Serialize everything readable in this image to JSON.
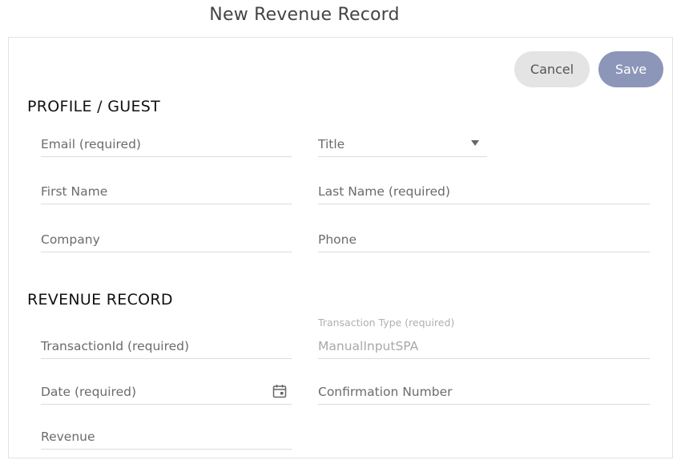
{
  "page": {
    "title": "New Revenue Record"
  },
  "actions": {
    "cancel_label": "Cancel",
    "save_label": "Save"
  },
  "sections": {
    "profile": {
      "title": "PROFILE / GUEST",
      "fields": {
        "email": "Email (required)",
        "title": "Title",
        "first_name": "First Name",
        "last_name": "Last Name (required)",
        "company": "Company",
        "phone": "Phone"
      }
    },
    "revenue": {
      "title": "REVENUE RECORD",
      "fields": {
        "transaction_id": "TransactionId (required)",
        "transaction_type_label": "Transaction Type (required)",
        "transaction_type_value": "ManualInputSPA",
        "date": "Date (required)",
        "confirmation_number": "Confirmation Number",
        "revenue": "Revenue"
      }
    }
  },
  "icons": {
    "title_dropdown": "caret-down-icon",
    "date_picker": "calendar-icon"
  },
  "colors": {
    "save_button": "#8b96b8",
    "cancel_button": "#e4e4e4"
  }
}
